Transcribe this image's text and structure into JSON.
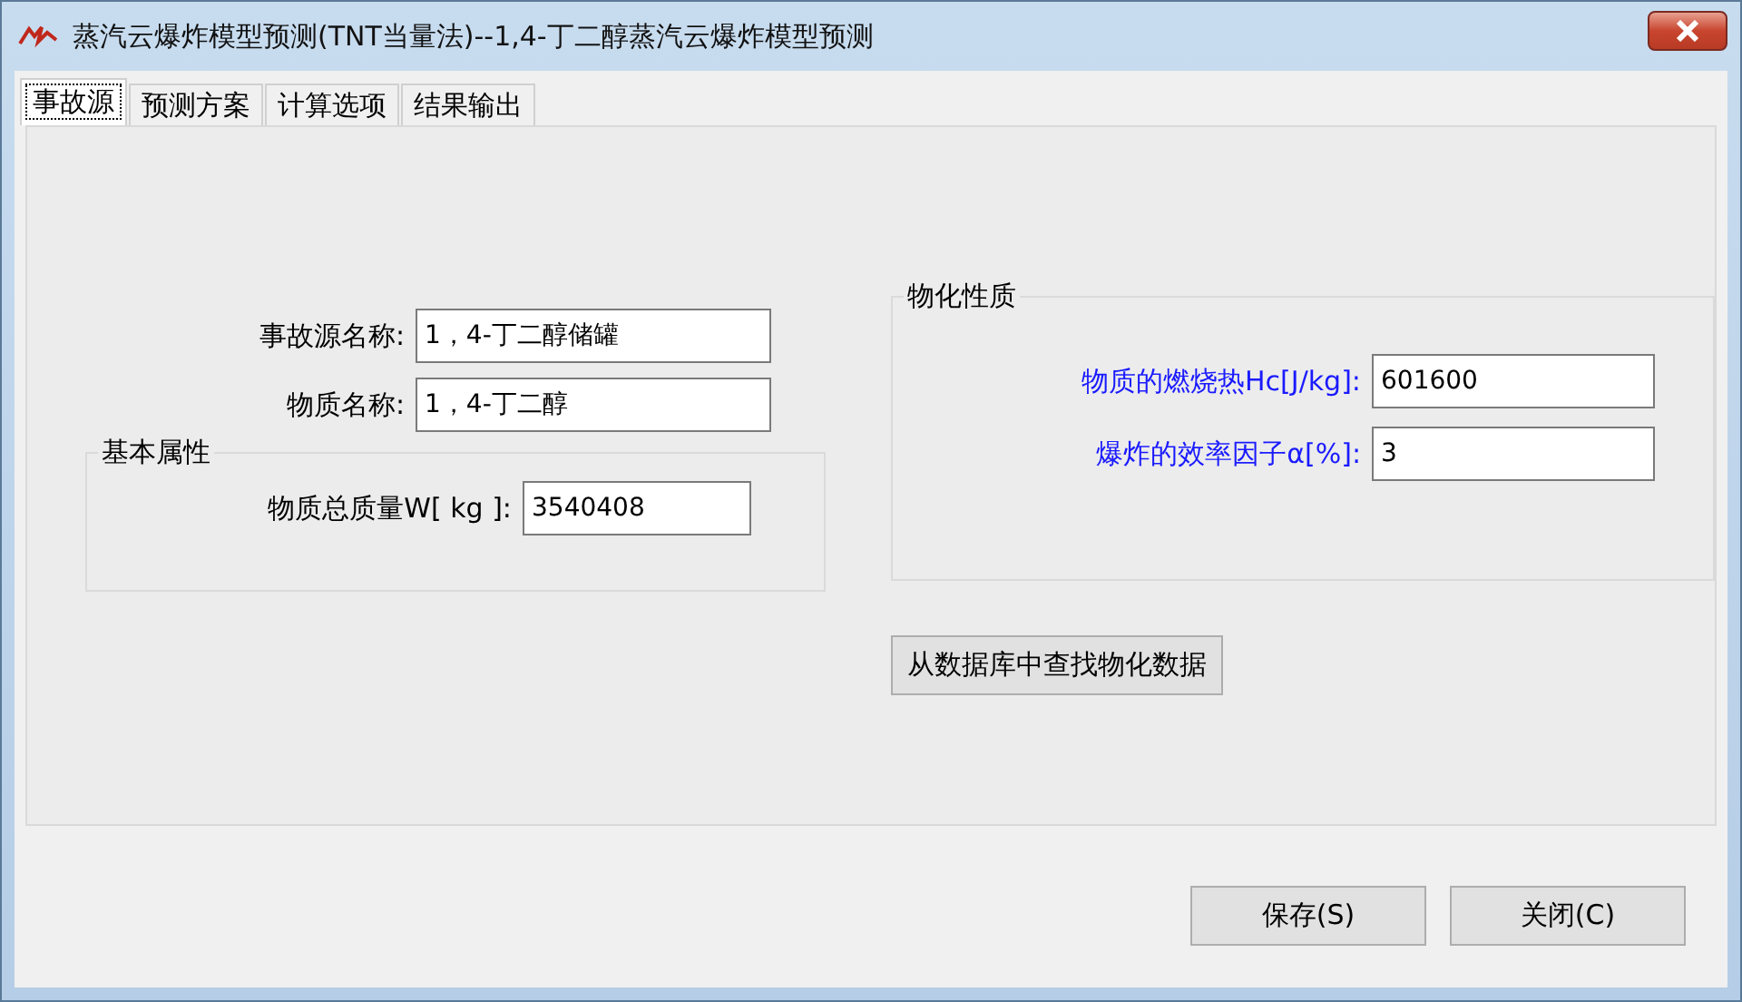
{
  "window": {
    "title": "蒸汽云爆炸模型预测(TNT当量法)--1,4-丁二醇蒸汽云爆炸模型预测"
  },
  "tabs": [
    {
      "label": "事故源",
      "selected": true
    },
    {
      "label": "预测方案",
      "selected": false
    },
    {
      "label": "计算选项",
      "selected": false
    },
    {
      "label": "结果输出",
      "selected": false
    }
  ],
  "source_fields": [
    {
      "label": "事故源名称:",
      "value": "1，4-丁二醇储罐"
    },
    {
      "label": "物质名称:",
      "value": "1，4-丁二醇"
    }
  ],
  "basic_properties": {
    "title": "基本属性",
    "fields": [
      {
        "label": "物质总质量W[ kg ]:",
        "value": "3540408"
      }
    ]
  },
  "physicochemical_properties": {
    "title": "物化性质",
    "fields": [
      {
        "label": "物质的燃烧热Hc[J/kg]:",
        "value": "601600",
        "color": "#1a1aff"
      },
      {
        "label": "爆炸的效率因子α[%]:",
        "value": "3",
        "color": "#1a1aff"
      }
    ]
  },
  "lookup_button": "从数据库中查找物化数据",
  "buttons": [
    "保存(S)",
    "关闭(C)"
  ]
}
